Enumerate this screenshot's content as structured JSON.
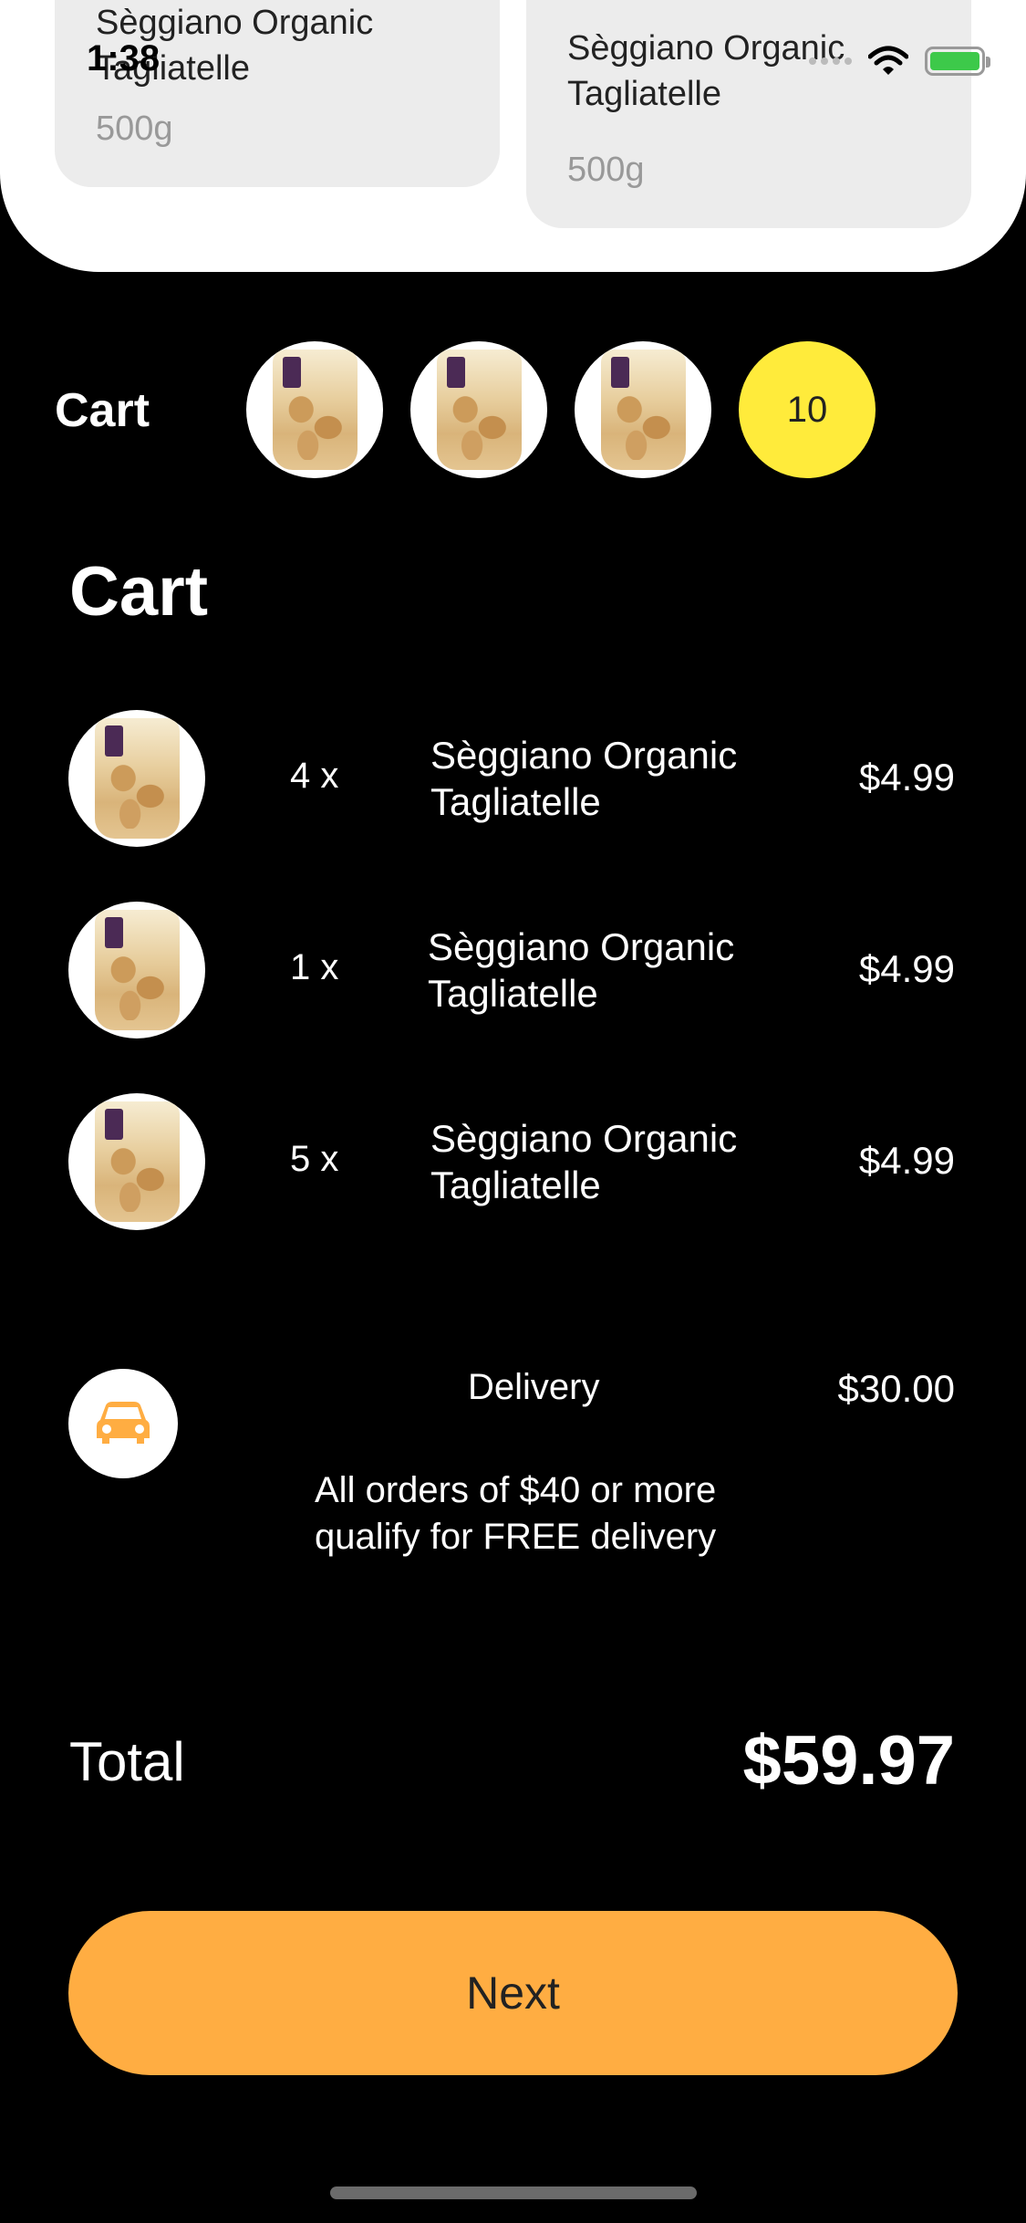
{
  "status_bar": {
    "time": "1:38"
  },
  "featured_products": [
    {
      "name": "Sèggiano Organic Tagliatelle",
      "weight": "500g"
    },
    {
      "name": "Sèggiano Organic Tagliatelle",
      "weight": "500g"
    }
  ],
  "cart_strip": {
    "label": "Cart",
    "item_count": "10"
  },
  "cart": {
    "title": "Cart",
    "items": [
      {
        "qty": "4 x",
        "name": "Sèggiano Organic Tagliatelle",
        "price": "$4.99"
      },
      {
        "qty": "1 x",
        "name": "Sèggiano Organic Tagliatelle",
        "price": "$4.99"
      },
      {
        "qty": "5 x",
        "name": "Sèggiano Organic Tagliatelle",
        "price": "$4.99"
      }
    ]
  },
  "delivery": {
    "icon": "car-icon",
    "label": "Delivery",
    "price": "$30.00",
    "note": "All orders of $40 or more qualify for FREE delivery"
  },
  "total": {
    "label": "Total",
    "value": "$59.97"
  },
  "actions": {
    "next_label": "Next"
  },
  "colors": {
    "accent": "#ffad42",
    "count_bubble": "#ffeb3b",
    "background": "#000000"
  }
}
